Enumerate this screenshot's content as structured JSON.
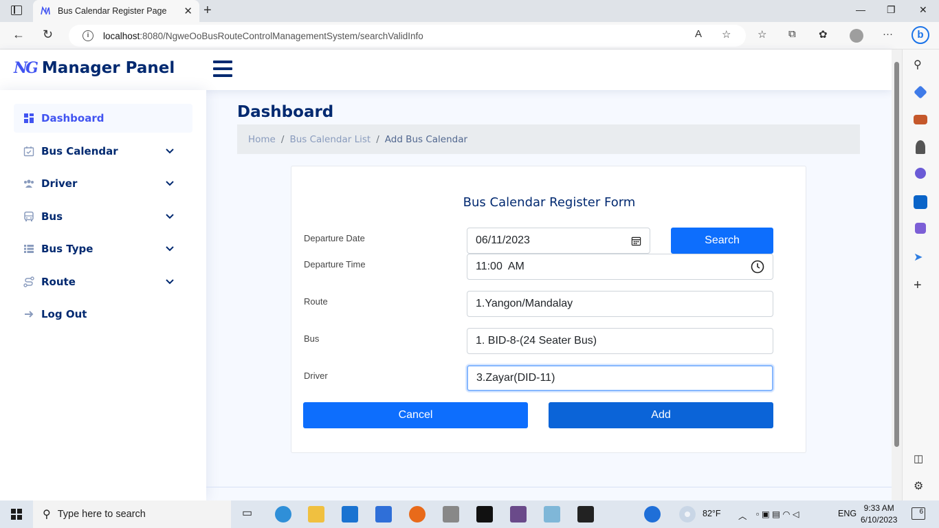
{
  "browser": {
    "tab_title": "Bus Calendar Register Page",
    "url_host": "localhost",
    "url_rest": ":8080/NgweOoBusRouteControlManagementSystem/searchValidInfo"
  },
  "header": {
    "logo_mark": "NG",
    "title": "Manager Panel"
  },
  "sidebar": {
    "items": [
      {
        "label": "Dashboard"
      },
      {
        "label": "Bus Calendar"
      },
      {
        "label": "Driver"
      },
      {
        "label": "Bus"
      },
      {
        "label": "Bus Type"
      },
      {
        "label": "Route"
      },
      {
        "label": "Log Out"
      }
    ]
  },
  "main": {
    "page_title": "Dashboard",
    "breadcrumb": [
      "Home",
      "Bus Calendar List",
      "Add Bus Calendar"
    ]
  },
  "form": {
    "title": "Bus Calendar Register Form",
    "departure_date_label": "Departure Date",
    "departure_date_value": "06/11/2023",
    "search_label": "Search",
    "departure_time_label": "Departure Time",
    "departure_time_value": "11:00  AM",
    "route_label": "Route",
    "route_value": "1.Yangon/Mandalay",
    "bus_label": "Bus",
    "bus_value": "1. BID-8-(24 Seater Bus)",
    "driver_label": "Driver",
    "driver_value": "3.Zayar(DID-11)",
    "cancel_label": "Cancel",
    "add_label": "Add"
  },
  "taskbar": {
    "search_placeholder": "Type here to search",
    "weather": "82°F",
    "language": "ENG",
    "time": "9:33 AM",
    "date": "6/10/2023",
    "notifications": "6"
  },
  "colors": {
    "brand": "#012970",
    "accent": "#4154f1",
    "primary_button": "#0d6efd"
  }
}
